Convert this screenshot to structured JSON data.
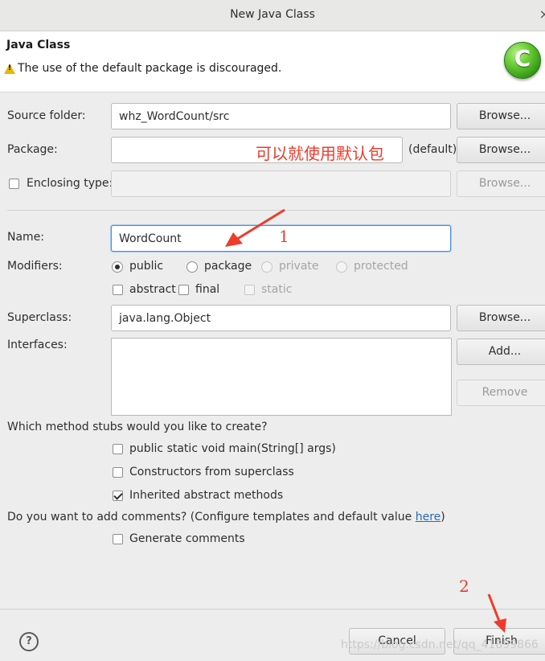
{
  "window": {
    "title": "New Java Class"
  },
  "header": {
    "title": "Java Class",
    "message": "The use of the default package is discouraged."
  },
  "form": {
    "source_folder": {
      "label": "Source folder:",
      "value": "whz_WordCount/src",
      "browse": "Browse..."
    },
    "package": {
      "label": "Package:",
      "value": "",
      "default_hint": "(default)",
      "browse": "Browse..."
    },
    "enclosing": {
      "label": "Enclosing type:",
      "value": "",
      "browse": "Browse..."
    },
    "name": {
      "label": "Name:",
      "value": "WordCount"
    },
    "modifiers": {
      "label": "Modifiers:",
      "public": "public",
      "package": "package",
      "private": "private",
      "protected": "protected",
      "abstract": "abstract",
      "final": "final",
      "static": "static"
    },
    "superclass": {
      "label": "Superclass:",
      "value": "java.lang.Object",
      "browse": "Browse..."
    },
    "interfaces": {
      "label": "Interfaces:",
      "add": "Add...",
      "remove": "Remove"
    },
    "stubs": {
      "question": "Which method stubs would you like to create?",
      "main": "public static void main(String[] args)",
      "constructors": "Constructors from superclass",
      "inherited": "Inherited abstract methods"
    },
    "comments": {
      "question_prefix": "Do you want to add comments? (Configure templates and default value ",
      "link": "here",
      "question_suffix": ")",
      "generate": "Generate comments"
    }
  },
  "annotations": {
    "package_note": "可以就使用默认包",
    "step1": "1",
    "step2": "2"
  },
  "footer": {
    "help": "?",
    "cancel": "Cancel",
    "finish": "Finish",
    "watermark": "https://blog.csdn.net/qq_41899866"
  },
  "colors": {
    "annotation": "#ee3b2b",
    "link": "#2a6ab8",
    "focus": "#4a90d9"
  }
}
